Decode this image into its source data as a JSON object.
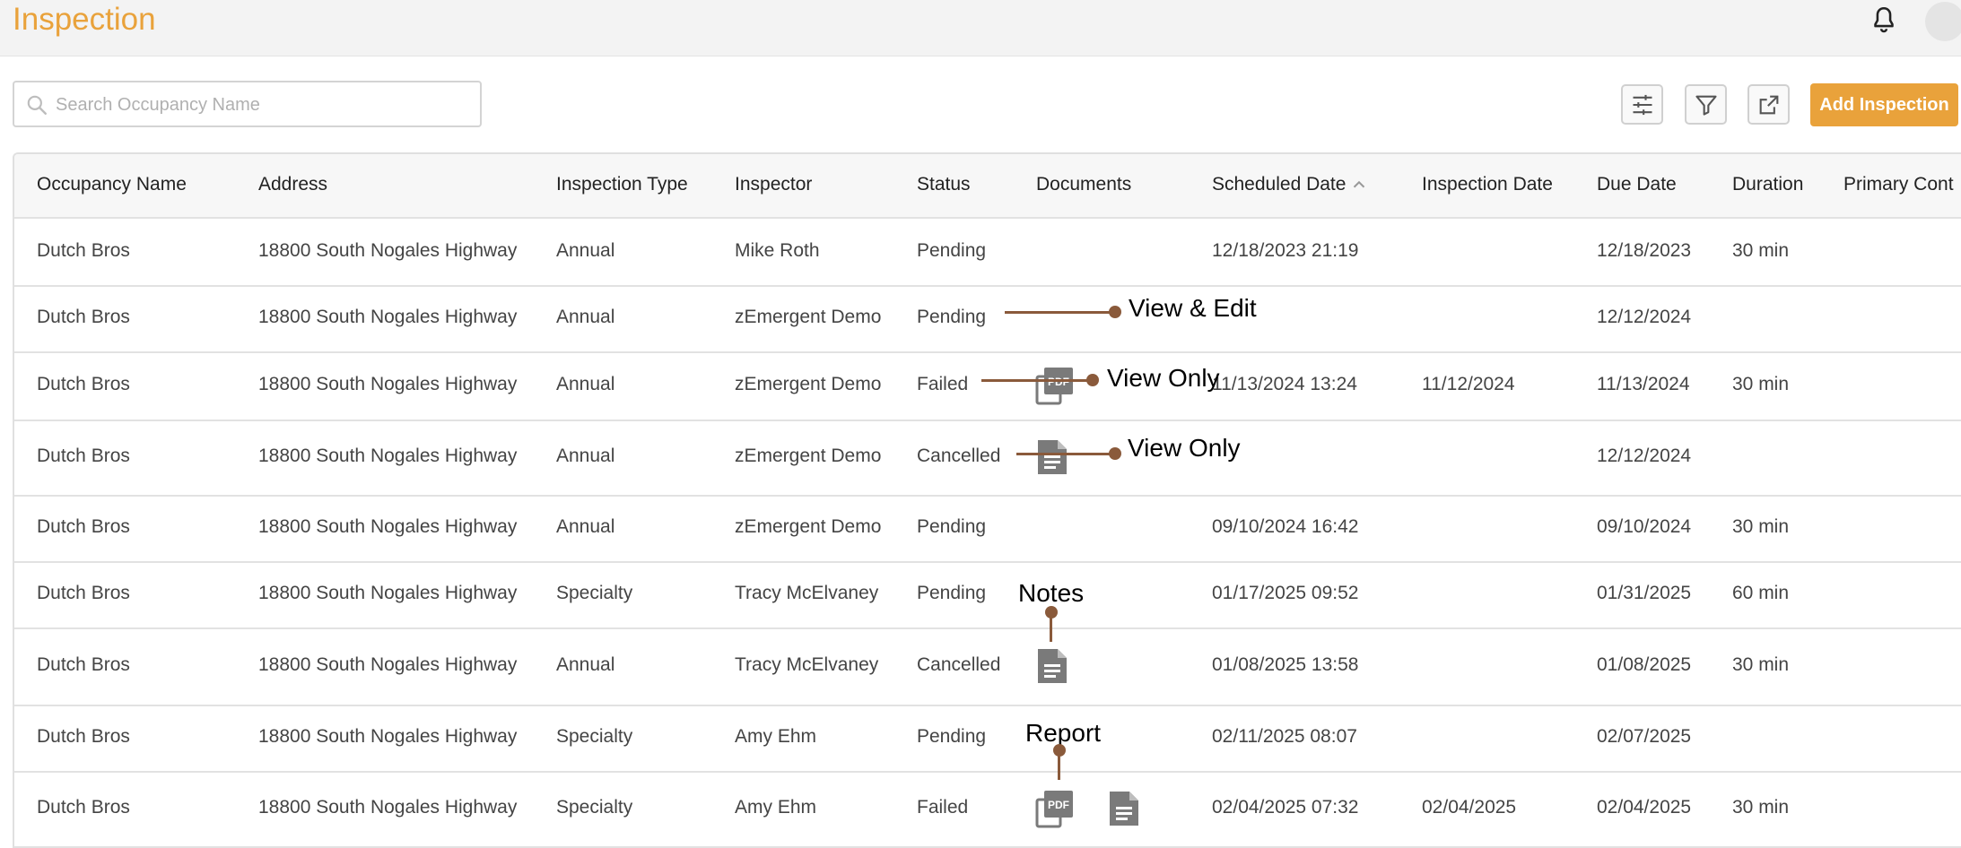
{
  "header": {
    "title": "Inspection"
  },
  "search": {
    "placeholder": "Search Occupancy Name"
  },
  "toolbar": {
    "add_label": "Add Inspection"
  },
  "columns": [
    "Occupancy Name",
    "Address",
    "Inspection Type",
    "Inspector",
    "Status",
    "Documents",
    "Scheduled Date",
    "Inspection Date",
    "Due Date",
    "Duration",
    "Primary Cont"
  ],
  "sort": {
    "column": "Scheduled Date",
    "direction": "ascending"
  },
  "rows": [
    [
      "Dutch Bros",
      "18800 South Nogales Highway",
      "Annual",
      "Mike Roth",
      "Pending",
      "",
      "12/18/2023 21:19",
      "",
      "12/18/2023",
      "30 min",
      ""
    ],
    [
      "Dutch Bros",
      "18800 South Nogales Highway",
      "Annual",
      "zEmergent Demo",
      "Pending",
      "",
      "",
      "",
      "12/12/2024",
      "",
      ""
    ],
    [
      "Dutch Bros",
      "18800 South Nogales Highway",
      "Annual",
      "zEmergent Demo",
      "Failed",
      "",
      "11/13/2024 13:24",
      "11/12/2024",
      "11/13/2024",
      "30 min",
      ""
    ],
    [
      "Dutch Bros",
      "18800 South Nogales Highway",
      "Annual",
      "zEmergent Demo",
      "Cancelled",
      "",
      "",
      "",
      "12/12/2024",
      "",
      ""
    ],
    [
      "Dutch Bros",
      "18800 South Nogales Highway",
      "Annual",
      "zEmergent Demo",
      "Pending",
      "",
      "09/10/2024 16:42",
      "",
      "09/10/2024",
      "30 min",
      ""
    ],
    [
      "Dutch Bros",
      "18800 South Nogales Highway",
      "Specialty",
      "Tracy McElvaney",
      "Pending",
      "",
      "01/17/2025 09:52",
      "",
      "01/31/2025",
      "60 min",
      ""
    ],
    [
      "Dutch Bros",
      "18800 South Nogales Highway",
      "Annual",
      "Tracy McElvaney",
      "Cancelled",
      "",
      "01/08/2025 13:58",
      "",
      "01/08/2025",
      "30 min",
      ""
    ],
    [
      "Dutch Bros",
      "18800 South Nogales Highway",
      "Specialty",
      "Amy Ehm",
      "Pending",
      "",
      "02/11/2025 08:07",
      "",
      "02/07/2025",
      "",
      ""
    ],
    [
      "Dutch Bros",
      "18800 South Nogales Highway",
      "Specialty",
      "Amy Ehm",
      "Failed",
      "",
      "02/04/2025 07:32",
      "02/04/2025",
      "02/04/2025",
      "30 min",
      ""
    ]
  ],
  "documents": [
    {
      "row": 2,
      "icons": [
        "pdf-icon"
      ]
    },
    {
      "row": 3,
      "icons": [
        "document-icon"
      ]
    },
    {
      "row": 6,
      "icons": [
        "document-icon"
      ]
    },
    {
      "row": 8,
      "icons": [
        "pdf-icon",
        "document-icon"
      ]
    }
  ],
  "annotations": {
    "view_edit": "View & Edit",
    "view_only_1": "View Only",
    "view_only_2": "View Only",
    "notes": "Notes",
    "report": "Report"
  },
  "colors": {
    "accent": "#e9a23b",
    "annotation": "#8a5a3b",
    "icon": "#7a7a7a"
  }
}
